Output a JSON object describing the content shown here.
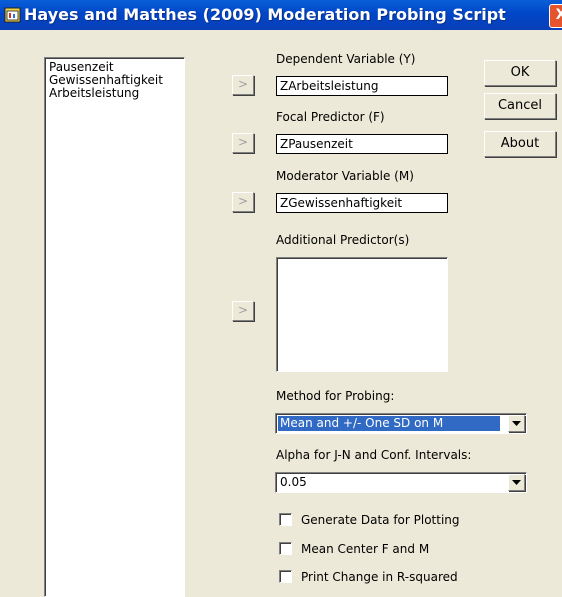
{
  "window": {
    "title": "Hayes and Matthes (2009) Moderation Probing Script",
    "close_glyph": "X"
  },
  "variable_list": [
    "Pausenzeit",
    "Gewissenhaftigkeit",
    "Arbeitsleistung"
  ],
  "arrow_glyph": ">",
  "fields": {
    "dependent": {
      "label": "Dependent Variable (Y)",
      "value": "ZArbeitsleistung"
    },
    "focal": {
      "label": "Focal Predictor (F)",
      "value": "ZPausenzeit"
    },
    "moderator": {
      "label": "Moderator Variable (M)",
      "value": "ZGewissenhaftigkeit"
    },
    "additional": {
      "label": "Additional Predictor(s)"
    }
  },
  "buttons": {
    "ok": "OK",
    "cancel": "Cancel",
    "about": "About"
  },
  "method": {
    "label": "Method for Probing:",
    "value": "Mean and +/- One SD on M"
  },
  "alpha": {
    "label": "Alpha for J-N and Conf. Intervals:",
    "value": "0.05"
  },
  "options": [
    {
      "label": "Generate Data for Plotting",
      "checked": false
    },
    {
      "label": "Mean Center F and M",
      "checked": false
    },
    {
      "label": "Print Change in R-squared",
      "checked": false
    }
  ],
  "colors": {
    "titlebar": "#0046c8",
    "selection": "#316ac5",
    "close": "#e5542c",
    "face": "#ece9d8"
  },
  "icons": {
    "app": "spss-window-icon",
    "close": "close-icon",
    "dropdown": "chevron-down-icon"
  }
}
